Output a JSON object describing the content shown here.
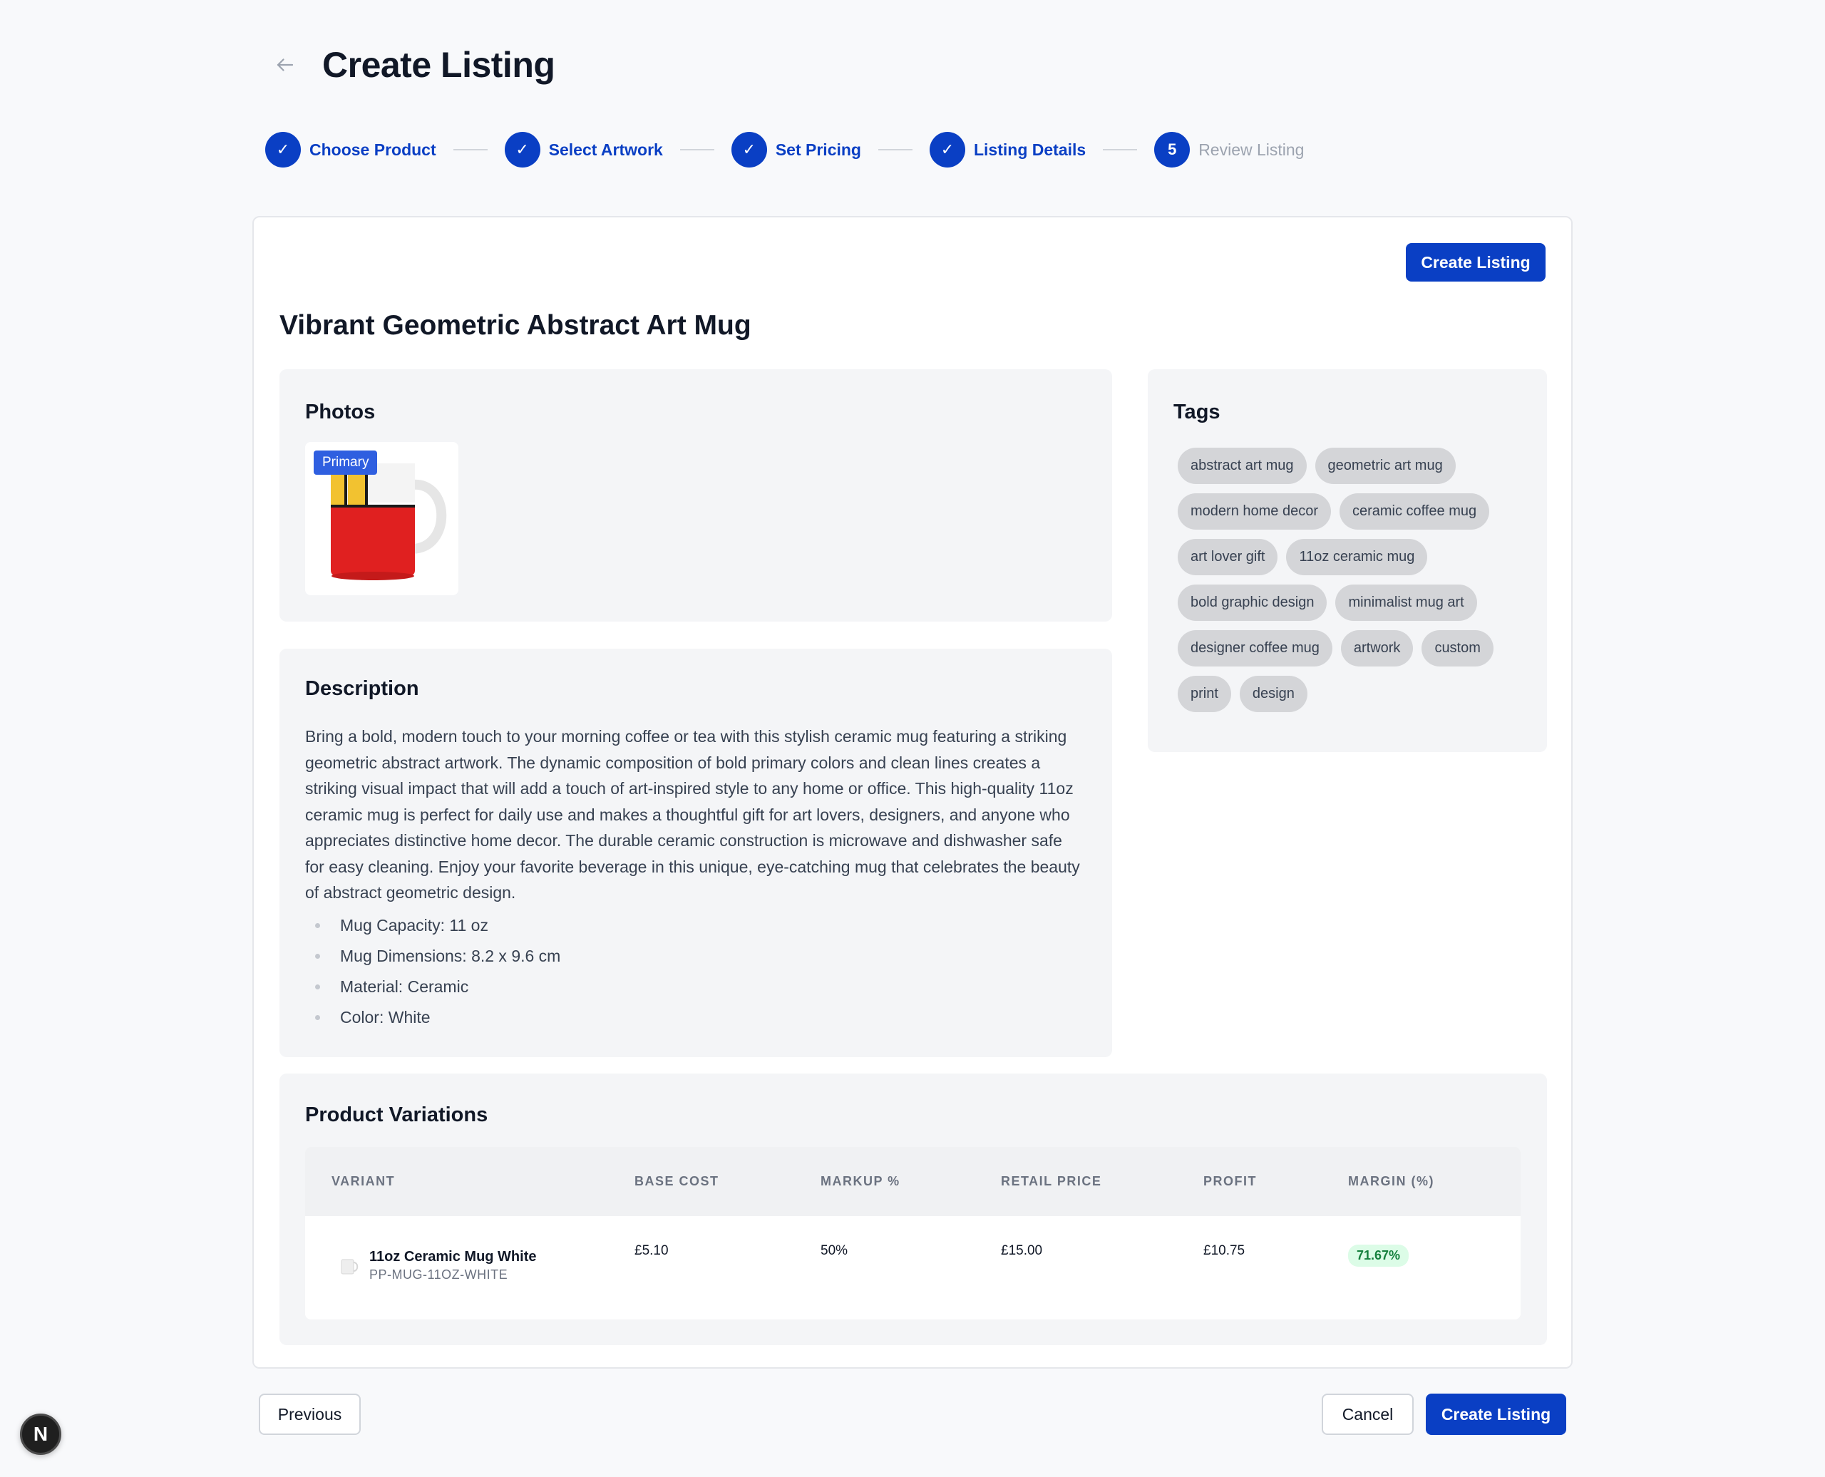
{
  "header": {
    "title": "Create Listing",
    "back_icon": "arrow-left-icon"
  },
  "stepper": {
    "steps": [
      {
        "label": "Choose Product",
        "status": "complete",
        "marker": "✓"
      },
      {
        "label": "Select Artwork",
        "status": "complete",
        "marker": "✓"
      },
      {
        "label": "Set Pricing",
        "status": "complete",
        "marker": "✓"
      },
      {
        "label": "Listing Details",
        "status": "complete",
        "marker": "✓"
      },
      {
        "label": "Review Listing",
        "status": "current",
        "marker": "5"
      }
    ]
  },
  "card": {
    "create_label": "Create Listing",
    "product_title": "Vibrant Geometric Abstract Art Mug"
  },
  "photos": {
    "title": "Photos",
    "primary_badge": "Primary"
  },
  "description": {
    "title": "Description",
    "text": "Bring a bold, modern touch to your morning coffee or tea with this stylish ceramic mug featuring a striking geometric abstract artwork. The dynamic composition of bold primary colors and clean lines creates a striking visual impact that will add a touch of art-inspired style to any home or office. This high-quality 11oz ceramic mug is perfect for daily use and makes a thoughtful gift for art lovers, designers, and anyone who appreciates distinctive home decor. The durable ceramic construction is microwave and dishwasher safe for easy cleaning. Enjoy your favorite beverage in this unique, eye-catching mug that celebrates the beauty of abstract geometric design.",
    "bullets": [
      "Mug Capacity: 11 oz",
      "Mug Dimensions: 8.2 x 9.6 cm",
      "Material: Ceramic",
      "Color: White"
    ]
  },
  "tags": {
    "title": "Tags",
    "items": [
      "abstract art mug",
      "geometric art mug",
      "modern home decor",
      "ceramic coffee mug",
      "art lover gift",
      "11oz ceramic mug",
      "bold graphic design",
      "minimalist mug art",
      "designer coffee mug",
      "artwork",
      "custom",
      "print",
      "design"
    ]
  },
  "variations": {
    "title": "Product Variations",
    "columns": [
      "VARIANT",
      "BASE COST",
      "MARKUP %",
      "RETAIL PRICE",
      "PROFIT",
      "MARGIN (%)"
    ],
    "rows": [
      {
        "name": "11oz Ceramic Mug White",
        "sku": "PP-MUG-11OZ-WHITE",
        "base_cost": "£5.10",
        "markup": "50%",
        "retail_price": "£15.00",
        "profit": "£10.75",
        "margin": "71.67%"
      }
    ]
  },
  "footer": {
    "previous_label": "Previous",
    "cancel_label": "Cancel",
    "create_label": "Create Listing"
  },
  "dev_badge": "N",
  "colors": {
    "primary": "#0a3fc4",
    "background": "#f8f9fb",
    "panel": "#f4f5f7",
    "tag": "#d4d5d8",
    "success_bg": "#dcfce7",
    "success_text": "#15803d"
  }
}
